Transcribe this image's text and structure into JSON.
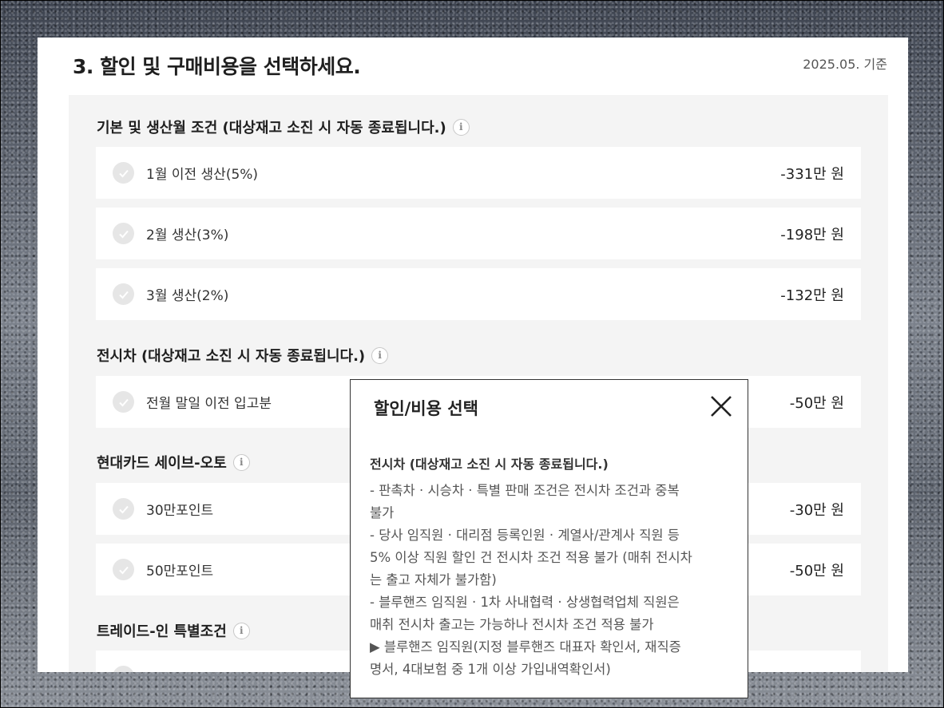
{
  "page": {
    "title": "3. 할인 및 구매비용을 선택하세요.",
    "date": "2025.05. 기준"
  },
  "sections": [
    {
      "title": "기본 및 생산월 조건 (대상재고 소진 시 자동 종료됩니다.)",
      "options": [
        {
          "label": "1월 이전 생산(5%)",
          "price": "-331만 원"
        },
        {
          "label": "2월 생산(3%)",
          "price": "-198만 원"
        },
        {
          "label": "3월 생산(2%)",
          "price": "-132만 원"
        }
      ]
    },
    {
      "title": "전시차 (대상재고 소진 시 자동 종료됩니다.)",
      "options": [
        {
          "label": "전월 말일 이전 입고분",
          "price": "-50만 원"
        }
      ]
    },
    {
      "title": "현대카드 세이브-오토",
      "options": [
        {
          "label": "30만포인트",
          "price": "-30만 원"
        },
        {
          "label": "50만포인트",
          "price": "-50만 원"
        }
      ]
    },
    {
      "title": "트레이드-인 특별조건",
      "options": [
        {
          "label": "",
          "price": ""
        }
      ]
    }
  ],
  "modal": {
    "title": "할인/비용 선택",
    "subtitle": "전시차 (대상재고 소진 시 자동 종료됩니다.)",
    "lines": [
      "- 판촉차 · 시승차 · 특별 판매 조건은 전시차 조건과 중복",
      "불가",
      "- 당사 임직원 · 대리점 등록인원 · 계열사/관계사 직원 등",
      "5% 이상 직원 할인 건 전시차 조건 적용 불가 (매취 전시차",
      "는 출고 자체가 불가함)",
      "- 블루핸즈 임직원 · 1차 사내협력 · 상생협력업체 직원은",
      "매취 전시차 출고는 가능하나 전시차 조건 적용 불가",
      "▶ 블루핸즈 임직원(지정 블루핸즈 대표자 확인서, 재직증",
      "명서, 4대보험 중 1개 이상 가입내역확인서)"
    ]
  },
  "icons": {
    "info": "info-icon",
    "check": "check-icon",
    "close": "close-icon"
  }
}
